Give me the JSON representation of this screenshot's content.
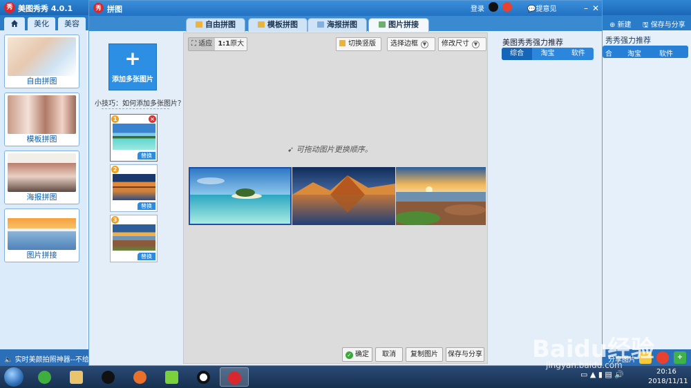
{
  "main_app": {
    "title": "美图秀秀 4.0.1",
    "tabs": [
      "美化",
      "美容"
    ],
    "templates": [
      {
        "label": "自由拼图"
      },
      {
        "label": "模板拼图"
      },
      {
        "label": "海报拼图"
      },
      {
        "label": "图片拼接"
      }
    ],
    "status_text": "实时美颜拍照神器--不给图",
    "right_panel": {
      "new_label": "新建",
      "save_share_label": "保存与分享",
      "title": "秀秀强力推荐",
      "segments": [
        "合",
        "淘宝",
        "软件"
      ],
      "share_label": "分享图片"
    }
  },
  "dialog": {
    "title": "拼图",
    "login_label": "登录",
    "feedback_label": "提意见",
    "tabs": [
      {
        "label": "自由拼图",
        "active": false
      },
      {
        "label": "模板拼图",
        "active": false
      },
      {
        "label": "海报拼图",
        "active": false
      },
      {
        "label": "图片拼接",
        "active": true
      }
    ],
    "add_button_label": "添加多张图片",
    "tip_text": "小技巧：如何添加多张图片？",
    "thumbnails": [
      {
        "number": "1",
        "replace_label": "替换",
        "scene": "island-sea"
      },
      {
        "number": "2",
        "replace_label": "替换",
        "scene": "mountain-lake"
      },
      {
        "number": "3",
        "replace_label": "替换",
        "scene": "sunset-rocks"
      }
    ],
    "zoom": {
      "fit_label": "适应",
      "actual_label": "原大",
      "actual_prefix": "1:1"
    },
    "toolbar": {
      "toggle_label": "切换竖版",
      "border_label": "选择边框",
      "resize_label": "修改尺寸"
    },
    "hint_text": "可拖动图片更换顺序。",
    "bottom_buttons": {
      "confirm": "确定",
      "cancel": "取消",
      "copy": "复制图片",
      "save_share": "保存与分享"
    },
    "recommend": {
      "title": "美图秀秀强力推荐",
      "segments": [
        "综合",
        "淘宝",
        "软件"
      ]
    }
  },
  "taskbar": {
    "time": "20:16",
    "date": "2018/11/11"
  },
  "watermark": {
    "brand": "Baidu经验",
    "url": "jingyan.baidu.com"
  },
  "colors": {
    "accent": "#2b86dc",
    "title_bar": "#2172c2",
    "taskbar": "#1d3a5f"
  }
}
